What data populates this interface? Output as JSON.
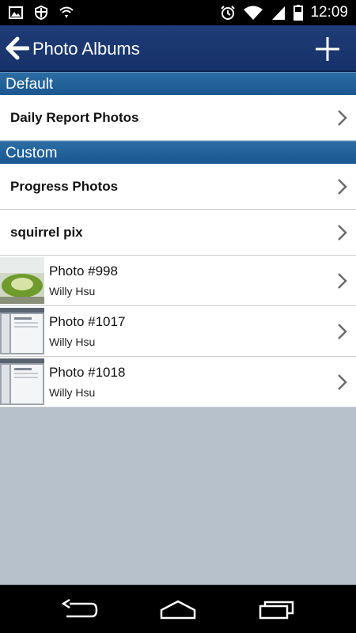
{
  "status_bar": {
    "time": "12:09",
    "icons": [
      "image-notification-icon",
      "shield-icon",
      "sync-icon",
      "alarm-icon",
      "wifi-icon",
      "signal-icon",
      "battery-icon"
    ]
  },
  "header": {
    "title": "Photo Albums",
    "back_icon": "arrow-left-icon",
    "add_icon": "plus-icon"
  },
  "sections": [
    {
      "title": "Default",
      "items": [
        {
          "label": "Daily Report Photos"
        }
      ]
    },
    {
      "title": "Custom",
      "items": [
        {
          "label": "Progress Photos"
        },
        {
          "label": "squirrel pix"
        }
      ],
      "photos": [
        {
          "title": "Photo #998",
          "author": "Willy Hsu",
          "thumb": "green-sculpture"
        },
        {
          "title": "Photo #1017",
          "author": "Willy Hsu",
          "thumb": "screenshot"
        },
        {
          "title": "Photo #1018",
          "author": "Willy Hsu",
          "thumb": "screenshot"
        }
      ]
    }
  ],
  "nav_bar": {
    "icons": [
      "back-nav-icon",
      "home-nav-icon",
      "recents-nav-icon"
    ]
  },
  "colors": {
    "action_bar": "#1e3c78",
    "section_header": "#2c6da3",
    "empty_background": "#b7c1cc"
  }
}
